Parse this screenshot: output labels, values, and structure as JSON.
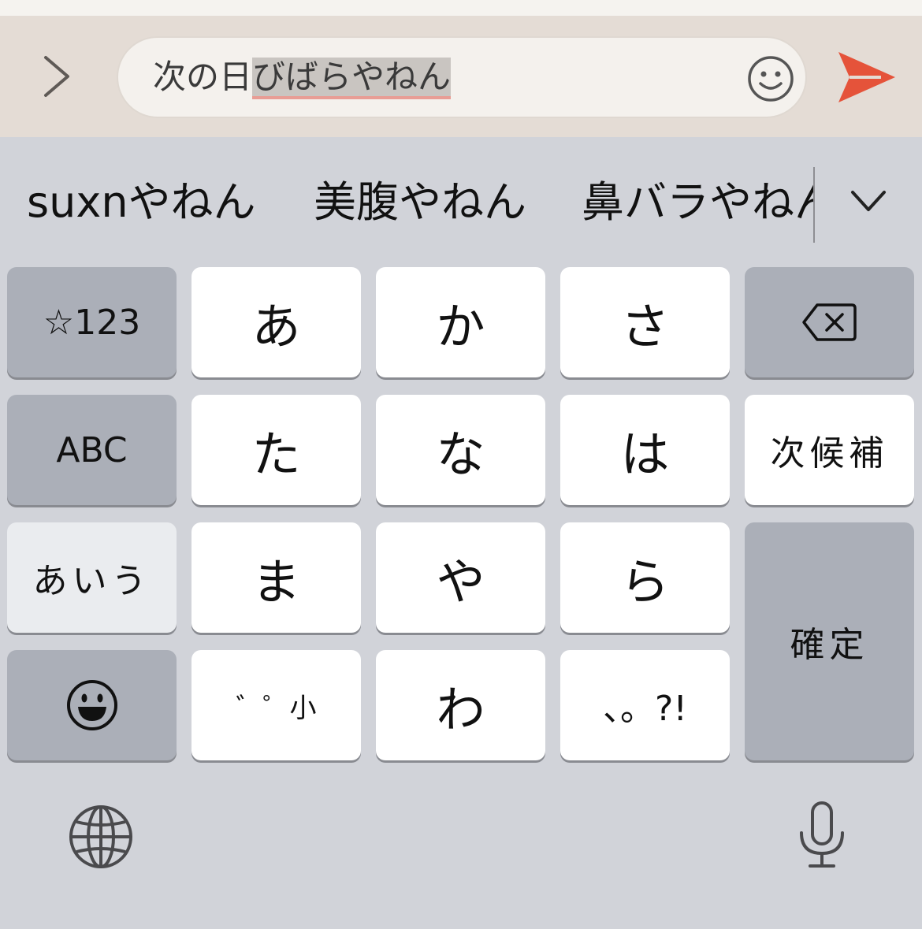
{
  "input_bar": {
    "committed_text": "次の日",
    "composing_text": "びばらやねん"
  },
  "colors": {
    "send_accent": "#e5533a",
    "composing_underline": "#e89d95",
    "keyboard_bg": "#d1d3d9"
  },
  "icons": {
    "expand": "chevron-right-icon",
    "emoji": "smiley-icon",
    "send": "paper-plane-icon",
    "candidates_more": "chevron-down-icon",
    "delete": "backspace-icon",
    "emoji_key": "grinning-face-icon",
    "globe": "globe-icon",
    "mic": "microphone-icon"
  },
  "suggestions": [
    "suxnやねん",
    "美腹やねん",
    "鼻バラやねん"
  ],
  "keyboard": {
    "row1": {
      "symbols": "☆123",
      "a": "あ",
      "ka": "か",
      "sa": "さ"
    },
    "row2": {
      "abc": "ABC",
      "ta": "た",
      "na": "な",
      "ha": "は",
      "next_candidate": "次候補"
    },
    "row3": {
      "hiragana": "あいう",
      "ma": "ま",
      "ya": "や",
      "ra": "ら",
      "confirm": "確定"
    },
    "row4": {
      "modifier": "゛゜小",
      "wa": "わ",
      "punct": "、。?!"
    }
  }
}
